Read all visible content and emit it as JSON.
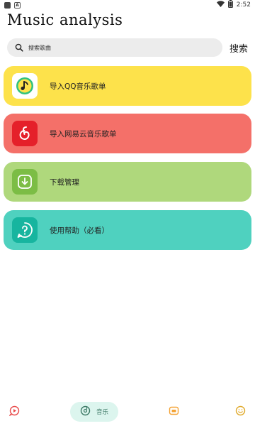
{
  "status_bar": {
    "time": "2:52",
    "left_icons": [
      "square-icon",
      "a-icon"
    ],
    "right_icons": [
      "wifi-icon",
      "battery-icon"
    ]
  },
  "app": {
    "title": "Music analysis"
  },
  "search": {
    "placeholder": "搜索歌曲",
    "button_label": "搜索"
  },
  "menu": [
    {
      "id": "qq",
      "label": "导入QQ音乐歌单",
      "icon": "qq-music-icon",
      "bg": "#fde24b"
    },
    {
      "id": "netease",
      "label": "导入网易云音乐歌单",
      "icon": "netease-music-icon",
      "bg": "#f47069"
    },
    {
      "id": "download",
      "label": "下载管理",
      "icon": "download-icon",
      "bg": "#afd87c"
    },
    {
      "id": "help",
      "label": "使用帮助（必看）",
      "icon": "help-icon",
      "bg": "#4fd1bf"
    }
  ],
  "bottom_nav": {
    "items": [
      {
        "id": "video",
        "icon": "video-icon",
        "active": false
      },
      {
        "id": "music",
        "icon": "music-disc-icon",
        "label": "音乐",
        "active": true
      },
      {
        "id": "box",
        "icon": "box-icon",
        "active": false
      },
      {
        "id": "me",
        "icon": "smile-icon",
        "active": false
      }
    ],
    "active_color": "#dcf5ee",
    "accent": "#f4a233"
  }
}
